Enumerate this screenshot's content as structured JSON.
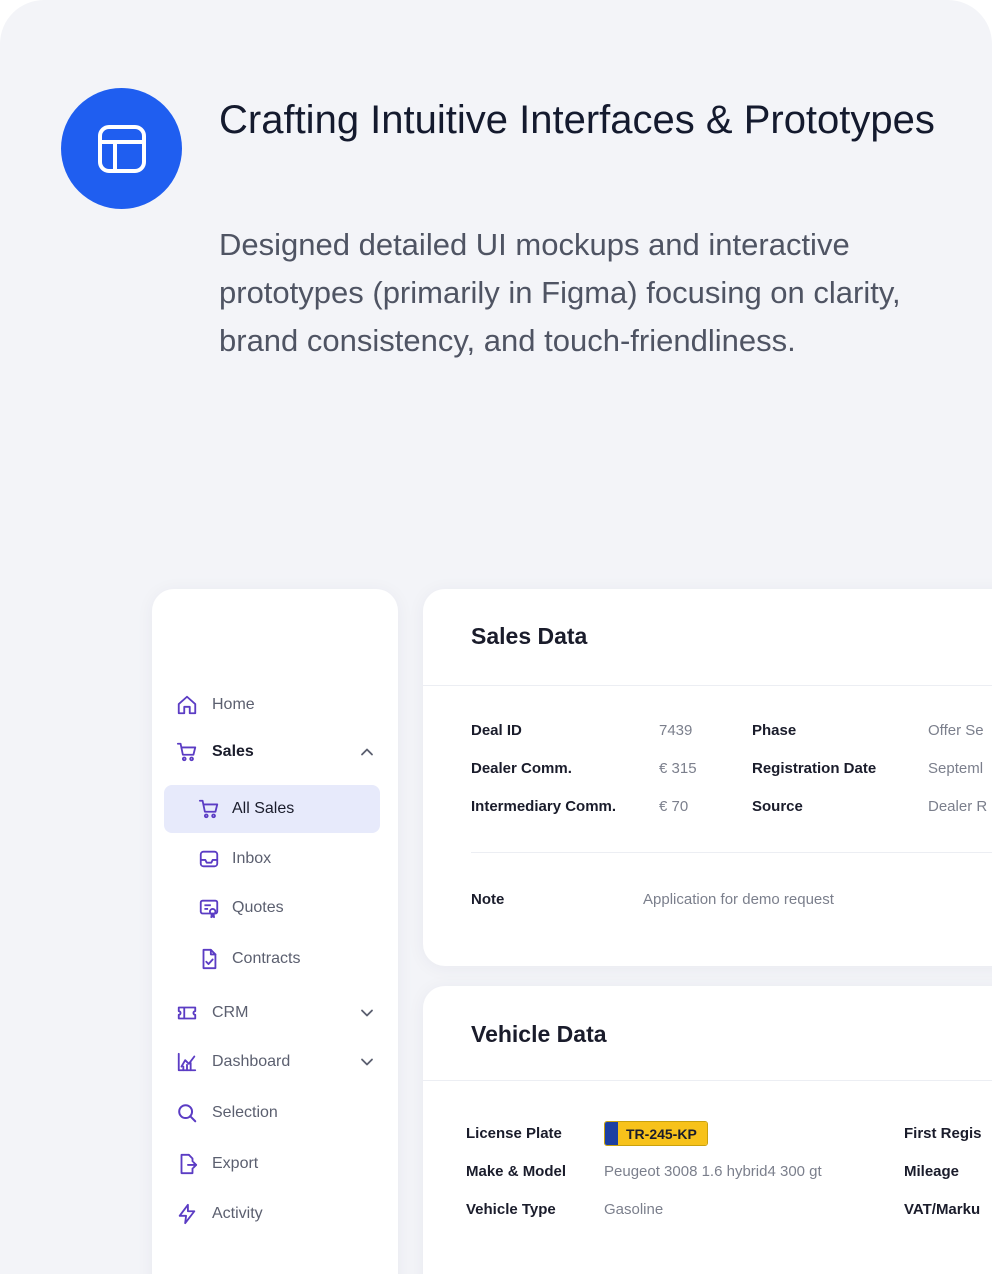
{
  "hero": {
    "title": "Crafting Intuitive Interfaces & Prototypes",
    "description": "Designed detailed UI mockups and interactive prototypes (primarily in Figma) focusing on clarity, brand consistency, and touch-friendliness.",
    "icon": "layout-icon",
    "accent": "#1f5ef0"
  },
  "sidebar": {
    "items": [
      {
        "label": "Home",
        "icon": "home-icon"
      },
      {
        "label": "Sales",
        "icon": "cart-icon",
        "expanded": true
      },
      {
        "label": "CRM",
        "icon": "ticket-icon"
      },
      {
        "label": "Dashboard",
        "icon": "chart-icon"
      },
      {
        "label": "Selection",
        "icon": "search-icon"
      },
      {
        "label": "Export",
        "icon": "export-icon"
      },
      {
        "label": "Activity",
        "icon": "bolt-icon"
      }
    ],
    "sales_children": [
      {
        "label": "All Sales",
        "icon": "cart-icon",
        "selected": true
      },
      {
        "label": "Inbox",
        "icon": "inbox-icon"
      },
      {
        "label": "Quotes",
        "icon": "quote-icon"
      },
      {
        "label": "Contracts",
        "icon": "contract-icon"
      }
    ],
    "icon_color": "#5b3cc4"
  },
  "sales_data": {
    "title": "Sales Data",
    "deal_id_label": "Deal ID",
    "deal_id": "7439",
    "dealer_comm_label": "Dealer Comm.",
    "dealer_comm": "€ 315",
    "intermediary_label": "Intermediary Comm.",
    "intermediary": "€ 70",
    "phase_label": "Phase",
    "phase": "Offer Se",
    "registration_label": "Registration Date",
    "registration": "Septeml",
    "source_label": "Source",
    "source": "Dealer R",
    "note_label": "Note",
    "note": "Application for demo request"
  },
  "vehicle_data": {
    "title": "Vehicle Data",
    "license_label": "License Plate",
    "license_plate": "TR-245-KP",
    "make_label": "Make & Model",
    "make_model": "Peugeot 3008 1.6 hybrid4 300 gt",
    "type_label": "Vehicle Type",
    "vehicle_type": "Gasoline",
    "first_reg_label": "First Regis",
    "mileage_label": "Mileage",
    "vat_label": "VAT/Marku"
  }
}
